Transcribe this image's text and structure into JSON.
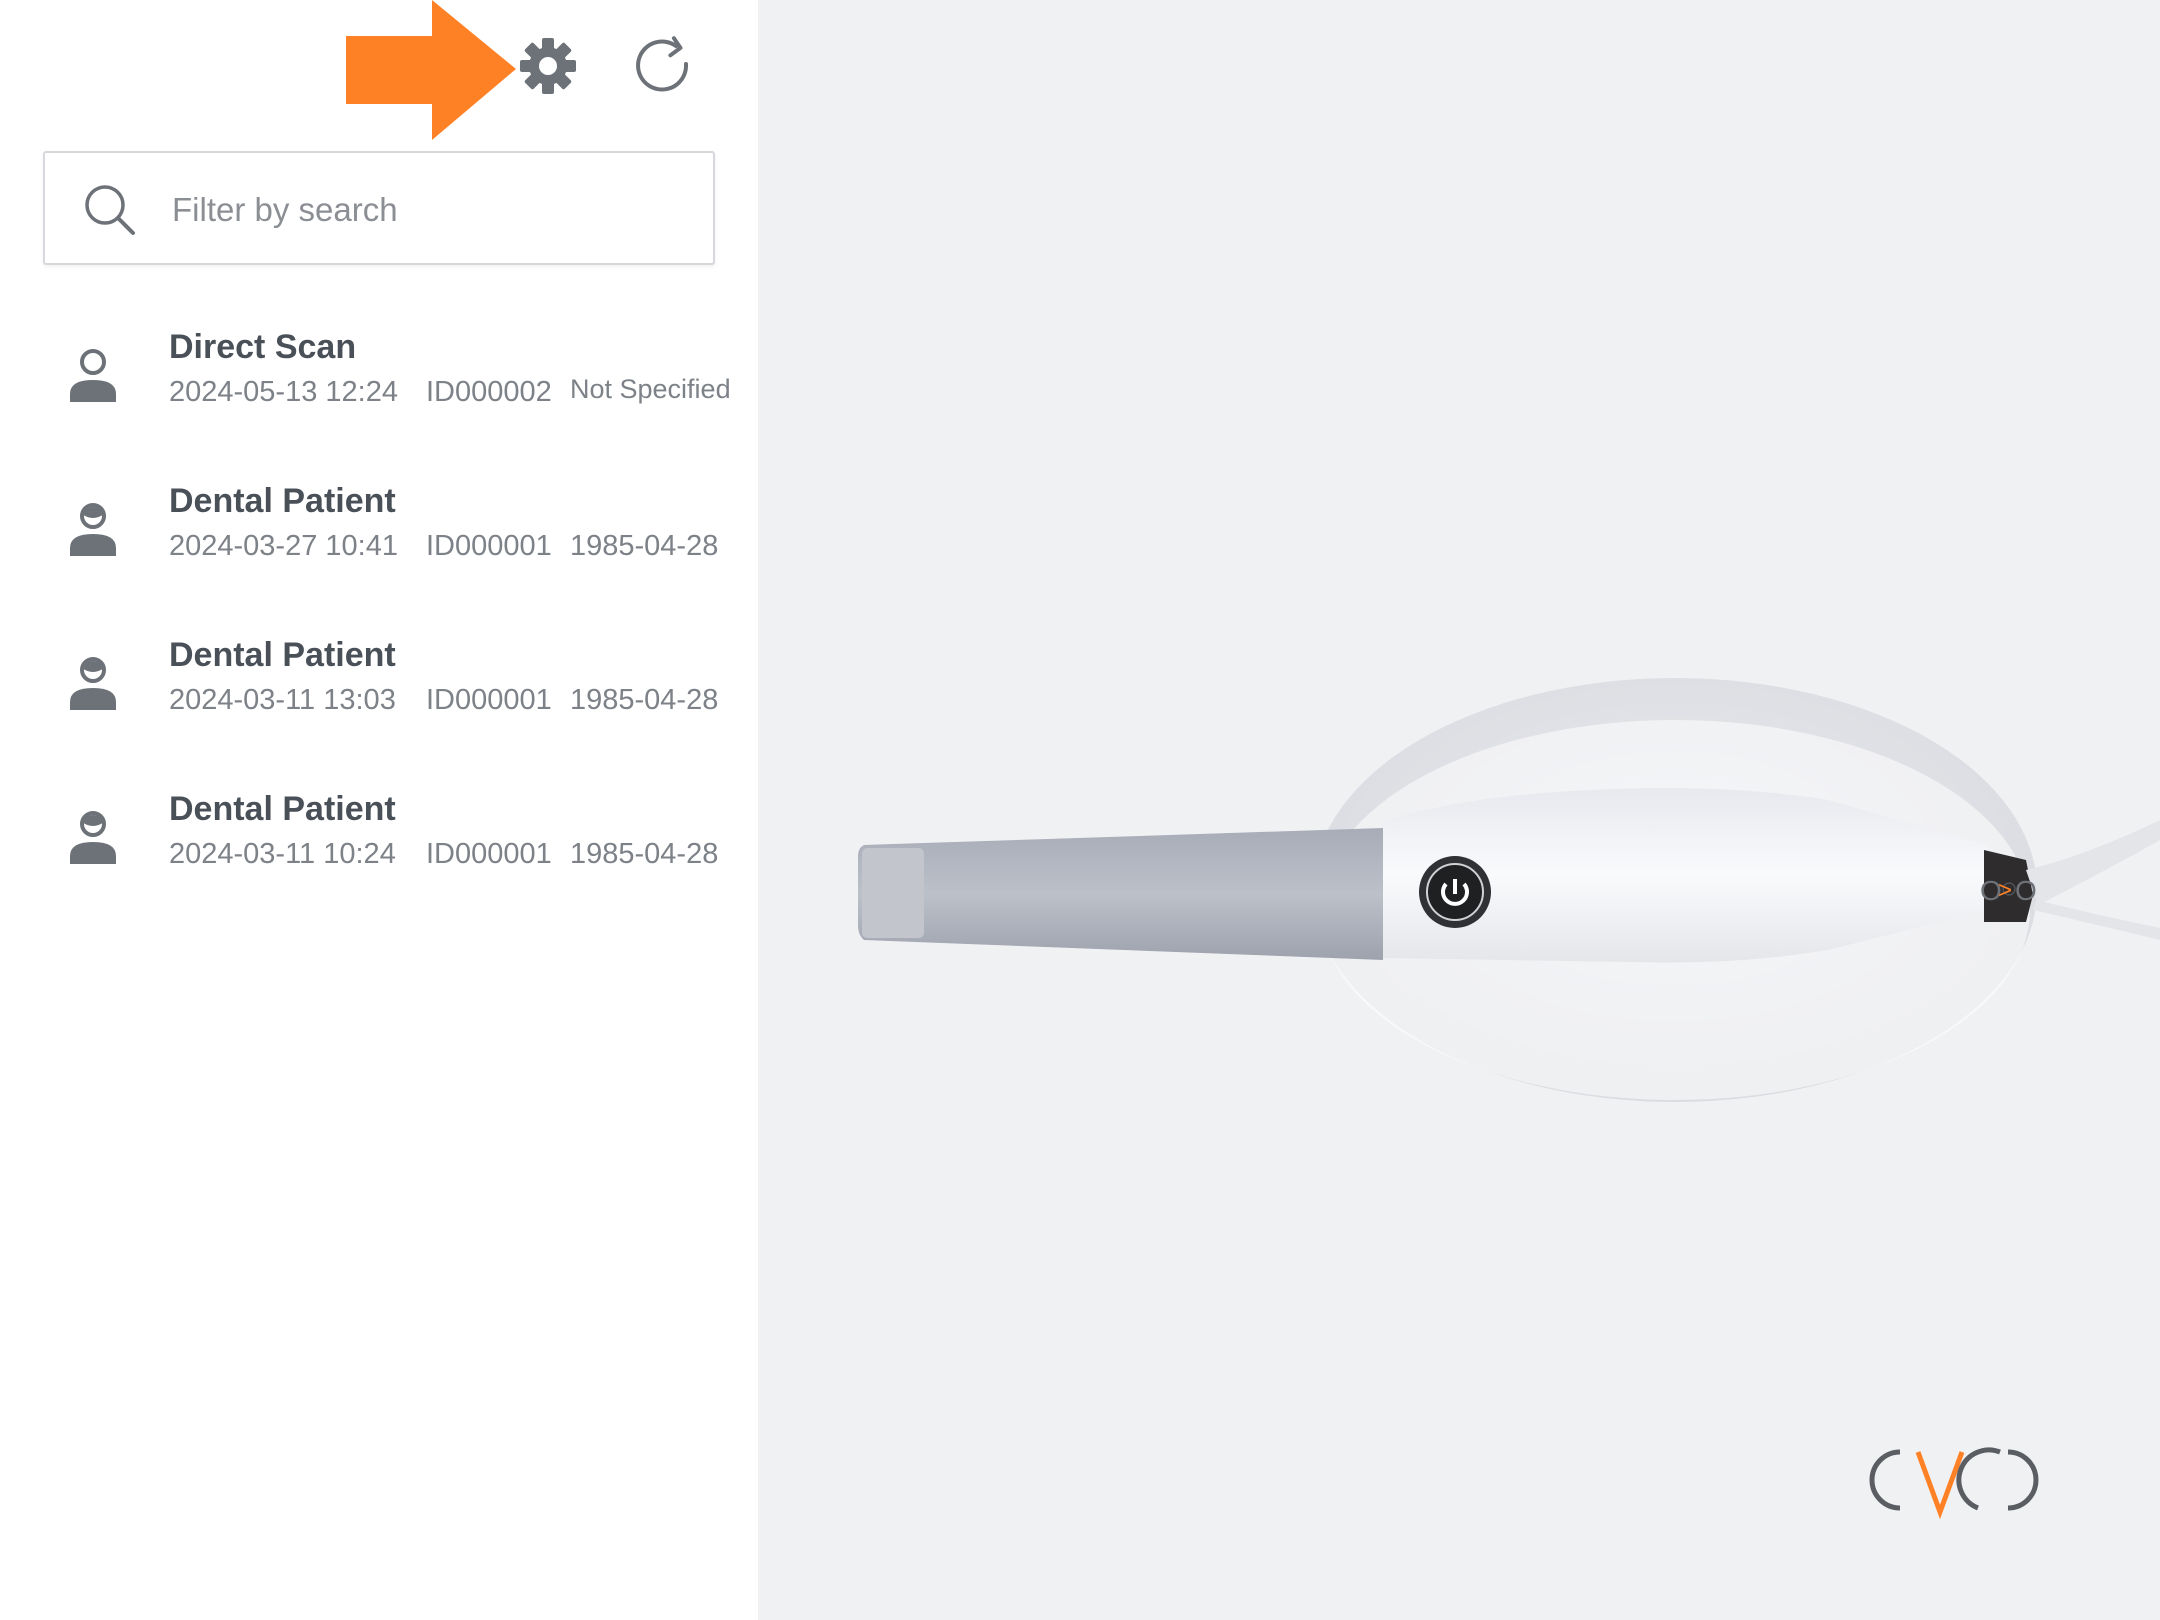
{
  "toolbar": {
    "settings_icon": "gear-icon",
    "refresh_icon": "refresh-icon",
    "highlight_arrow_color": "#ff8125"
  },
  "search": {
    "placeholder": "Filter by search",
    "value": ""
  },
  "patients": [
    {
      "name": "Direct Scan",
      "date": "2024-05-13 12:24",
      "id": "ID000002",
      "dob": "Not Specified"
    },
    {
      "name": "Dental Patient",
      "date": "2024-03-27 10:41",
      "id": "ID000001",
      "dob": "1985-04-28"
    },
    {
      "name": "Dental Patient",
      "date": "2024-03-11 13:03",
      "id": "ID000001",
      "dob": "1985-04-28"
    },
    {
      "name": "Dental Patient",
      "date": "2024-03-11 10:24",
      "id": "ID000001",
      "dob": "1985-04-28"
    }
  ],
  "colors": {
    "accent": "#ff8125",
    "icon_gray": "#6d7278",
    "text_dark": "#4a5058",
    "text_muted": "#7d8288",
    "background_main": "#f0f1f3"
  }
}
